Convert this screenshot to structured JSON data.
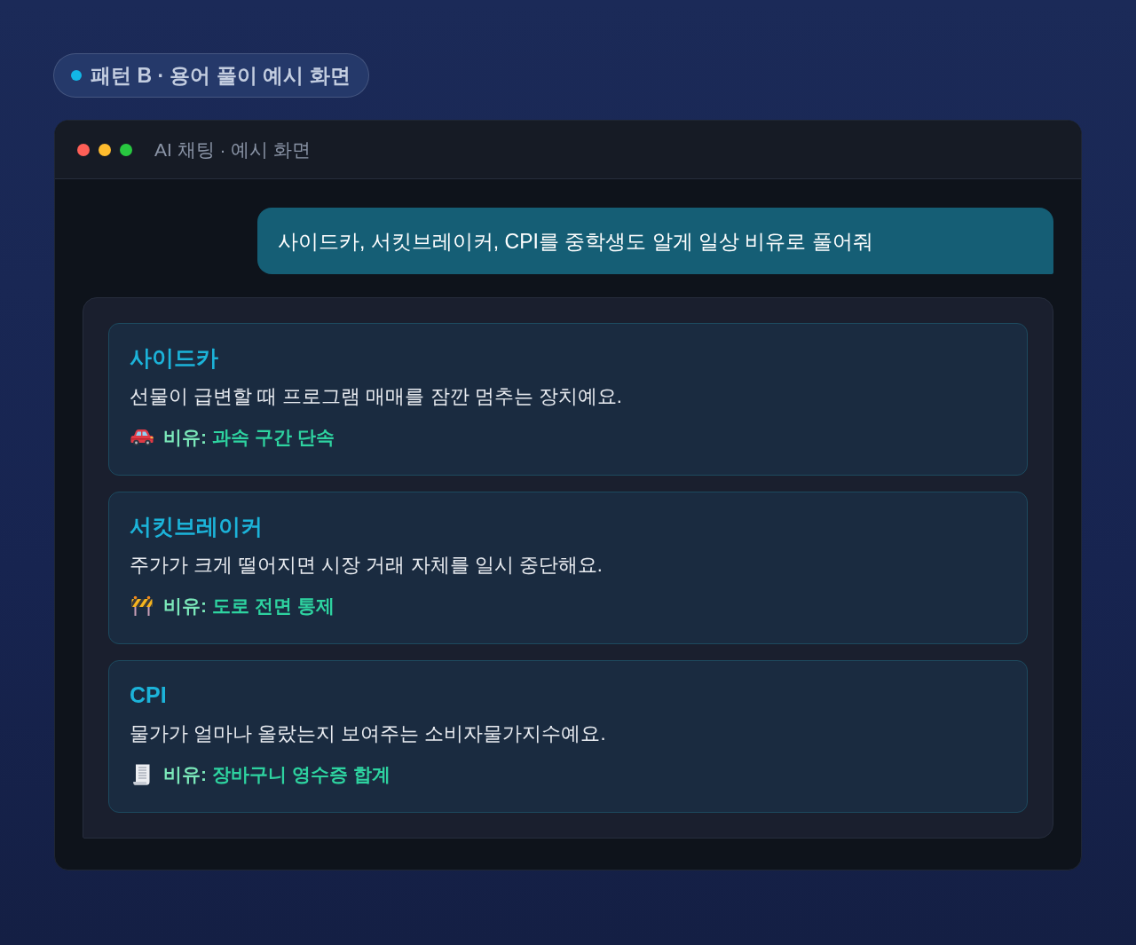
{
  "badge": {
    "text": "패턴 B · 용어 풀이 예시 화면"
  },
  "window": {
    "title": "AI 채팅 · 예시 화면"
  },
  "user_message": {
    "text": "사이드카, 서킷브레이커, CPI를 중학생도 알게 일상 비유로 풀어줘"
  },
  "answer": {
    "terms": [
      {
        "term": "사이드카",
        "description": "선물이 급변할 때 프로그램 매매를 잠깐 멈추는 장치예요.",
        "analogy_label": "비유:",
        "analogy": "과속 구간 단속"
      },
      {
        "term": "서킷브레이커",
        "description": "주가가 크게 떨어지면 시장 거래 자체를 일시 중단해요.",
        "analogy_label": "비유:",
        "analogy": "도로 전면 통제"
      },
      {
        "term": "CPI",
        "description": "물가가 얼마나 올랐는지 보여주는 소비자물가지수예요.",
        "analogy_label": "비유:",
        "analogy": "장바구니 영수증 합계"
      }
    ]
  }
}
